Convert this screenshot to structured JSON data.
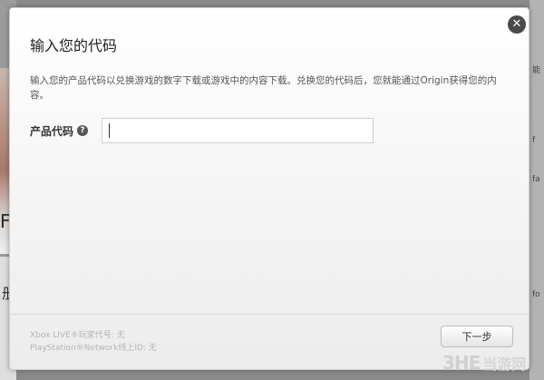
{
  "dialog": {
    "title": "输入您的代码",
    "description": "输入您的产品代码以兑换游戏的数字下载或游戏中的内容下载。兑换您的代码后，您就能通过Origin获得您的内容。",
    "close_symbol": "✕",
    "field": {
      "label": "产品代码",
      "help_symbol": "?",
      "value": "",
      "placeholder": ""
    },
    "footer": {
      "xbox_line": "Xbox LIVE®玩家代号: 无",
      "psn_line": "PlayStation®Network线上ID: 无"
    },
    "next_label": "下一步"
  },
  "background": {
    "left_glyph": "F",
    "left_glyph2": "册",
    "right_glyphs": [
      "能",
      "f",
      "fa",
      "fo"
    ]
  },
  "watermark": {
    "logo": "3HE",
    "text": "当游网"
  }
}
